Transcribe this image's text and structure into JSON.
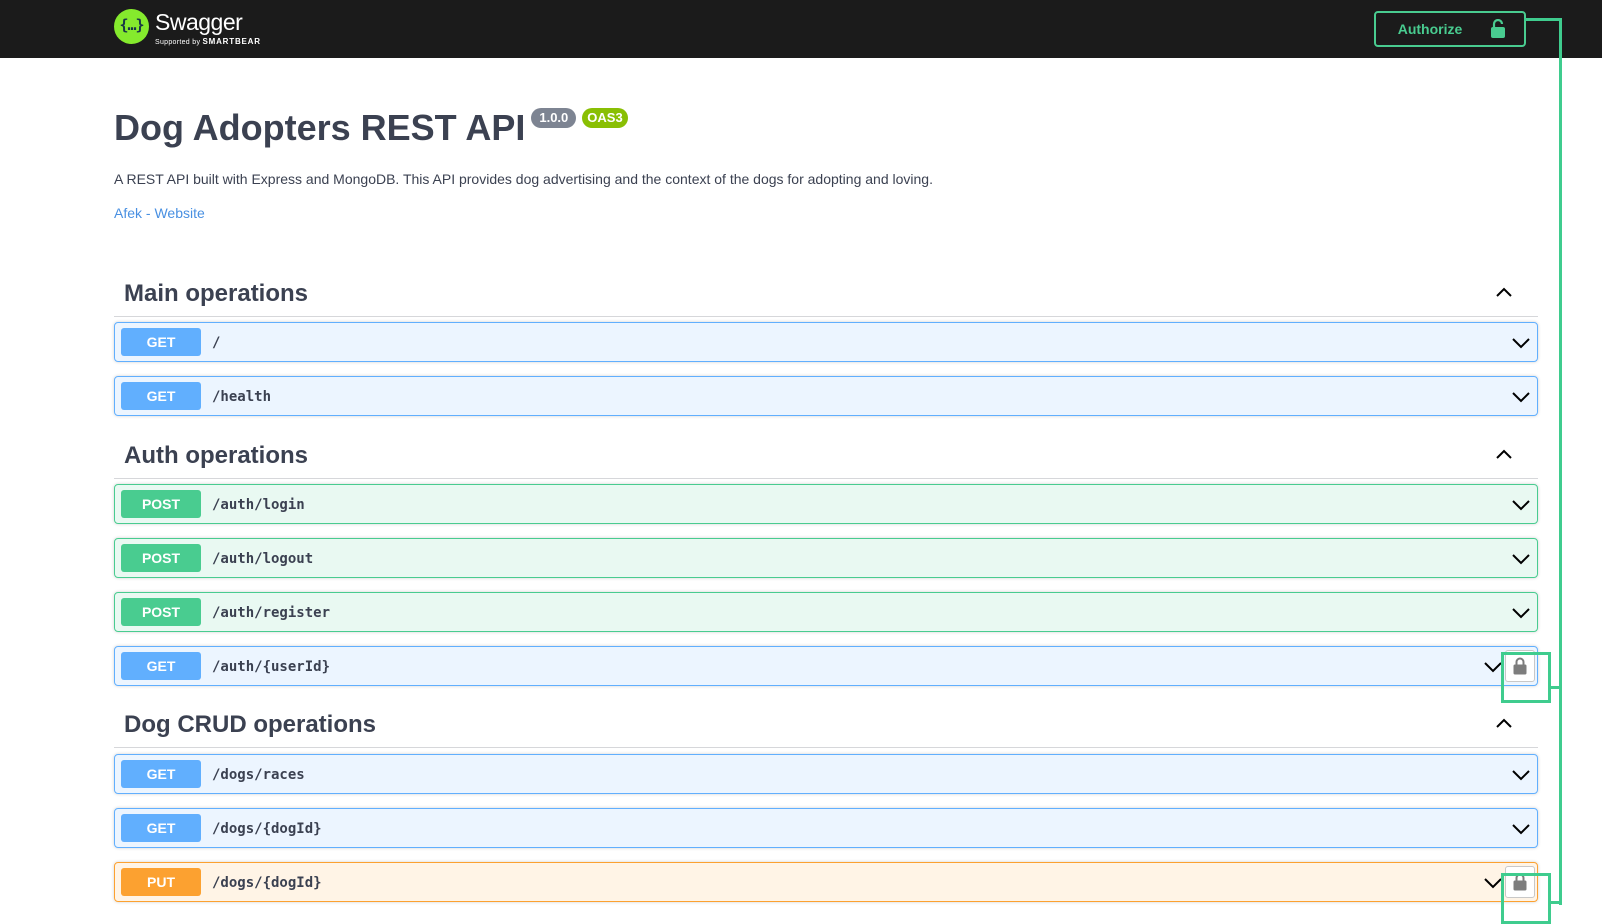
{
  "header": {
    "logo_name": "Swagger",
    "logo_sub_prefix": "Supported by",
    "logo_sub_brand": "SMARTBEAR",
    "authorize_label": "Authorize"
  },
  "info": {
    "title": "Dog Adopters REST API",
    "version": "1.0.0",
    "oas": "OAS3",
    "description": "A REST API built with Express and MongoDB. This API provides dog advertising and the context of the dogs for adopting and loving.",
    "link_text": "Afek - Website"
  },
  "tags": [
    {
      "name": "Main operations",
      "operations": [
        {
          "method": "GET",
          "path": "/"
        },
        {
          "method": "GET",
          "path": "/health"
        }
      ]
    },
    {
      "name": "Auth operations",
      "operations": [
        {
          "method": "POST",
          "path": "/auth/login"
        },
        {
          "method": "POST",
          "path": "/auth/logout"
        },
        {
          "method": "POST",
          "path": "/auth/register"
        },
        {
          "method": "GET",
          "path": "/auth/{userId}",
          "locked": true
        }
      ]
    },
    {
      "name": "Dog CRUD operations",
      "operations": [
        {
          "method": "GET",
          "path": "/dogs/races"
        },
        {
          "method": "GET",
          "path": "/dogs/{dogId}"
        },
        {
          "method": "PUT",
          "path": "/dogs/{dogId}",
          "locked": true
        }
      ]
    }
  ],
  "colors": {
    "get": "#61affe",
    "post": "#49cc90",
    "put": "#fca130",
    "highlight": "#3fcc8e",
    "topbar": "#1b1b1b"
  },
  "icons": [
    "swagger-logo-icon",
    "unlocked-lock-icon",
    "chevron-up-icon",
    "chevron-down-icon",
    "locked-lock-icon"
  ]
}
